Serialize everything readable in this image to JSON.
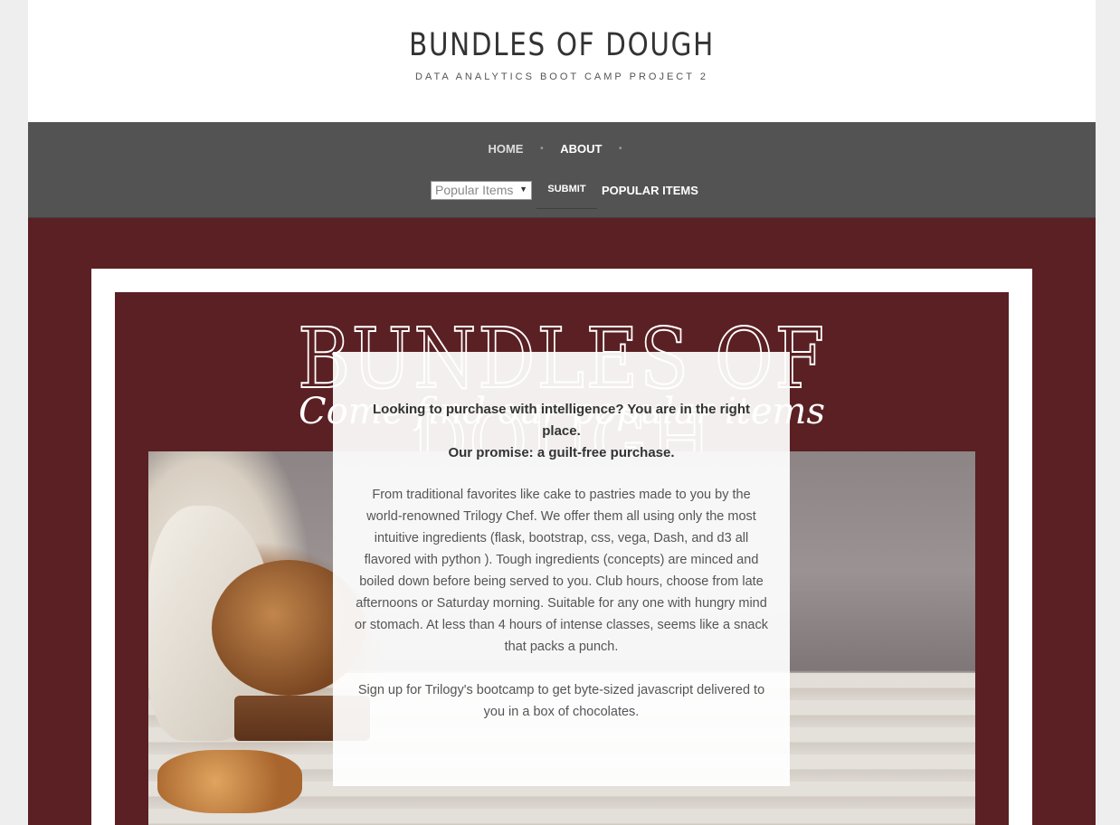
{
  "header": {
    "title": "BUNDLES OF DOUGH",
    "subtitle": "DATA ANALYTICS BOOT CAMP PROJECT 2"
  },
  "nav": {
    "items": [
      {
        "label": "HOME"
      },
      {
        "label": "ABOUT"
      }
    ],
    "dot": "•",
    "select_value": "Popular Items",
    "submit_label": "SUBMIT",
    "popular_label": "POPULAR ITEMS"
  },
  "hero": {
    "brand_title": "BUNDLES OF DOUGH",
    "brand_script": "Come find our popular items",
    "lead_line1": "Looking to purchase with intelligence? You are in the right place.",
    "lead_line2": "Our promise: a guilt-free purchase.",
    "body": "From traditional favorites like cake to pastries made to you by the world-renowned Trilogy Chef. We offer them all using only the most intuitive ingredients (flask, bootstrap, css, vega, Dash, and d3 all flavored with python ). Tough ingredients (concepts) are minced and boiled down before being served to you. Club hours, choose from late afternoons or Saturday morning. Suitable for any one with hungry mind or stomach. At less than 4 hours of intense classes, seems like a snack that packs a punch.",
    "signup": "Sign up for Trilogy's bootcamp to get byte-sized javascript delivered to you in a box of chocolates."
  },
  "colors": {
    "hero_background": "#5a2023",
    "navbar": "#535353",
    "frame": "#ffffff"
  }
}
